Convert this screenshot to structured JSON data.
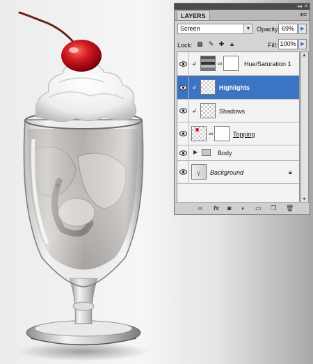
{
  "panel": {
    "tab_label": "LAYERS",
    "collapse_icon": "double-arrow-icon",
    "close_icon": "close-icon",
    "menu_icon": "panel-menu-icon",
    "blend_mode": "Screen",
    "opacity_label": "Opacity:",
    "opacity_value": "69%",
    "lock_label": "Lock:",
    "fill_label": "Fill:",
    "fill_value": "100%"
  },
  "layers": [
    {
      "name": "Hue/Saturation 1",
      "type": "adjustment",
      "visible": true,
      "selected": false,
      "clipped": true
    },
    {
      "name": "Highlights",
      "type": "pixel",
      "visible": true,
      "selected": true,
      "clipped": true
    },
    {
      "name": "Shadows",
      "type": "pixel",
      "visible": true,
      "selected": false,
      "clipped": true
    },
    {
      "name": "Topping",
      "type": "pixel-with-mask",
      "visible": true,
      "selected": false,
      "clipped": false
    },
    {
      "name": "Body",
      "type": "group",
      "visible": true,
      "selected": false,
      "clipped": false
    },
    {
      "name": "Background",
      "type": "background",
      "visible": true,
      "selected": false,
      "locked": true
    }
  ],
  "bottom_icons": [
    "link-layers-icon",
    "fx-icon",
    "add-mask-icon",
    "adjustment-icon",
    "new-group-icon",
    "new-layer-icon",
    "trash-icon"
  ],
  "colors": {
    "selection": "#3c74c4",
    "cherry": "#c8141c",
    "panel_bg": "#d4d4d4"
  }
}
